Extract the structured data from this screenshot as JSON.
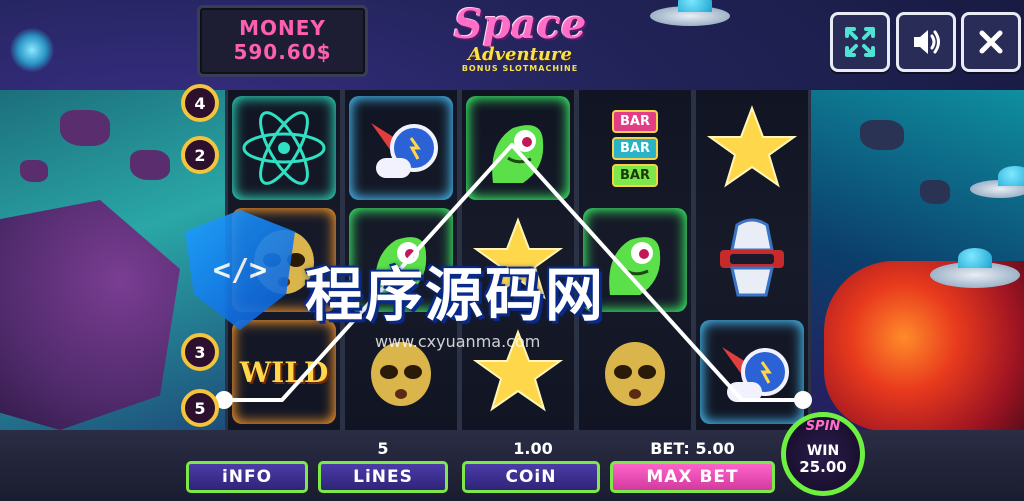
{
  "header": {
    "money_label": "MONEY",
    "money_value": "590.60$",
    "logo_main": "Space",
    "logo_sub": "Adventure",
    "logo_tag": "BONUS SLOTMACHINE"
  },
  "top_buttons": [
    {
      "name": "fullscreen-button",
      "icon": "fullscreen-icon"
    },
    {
      "name": "sound-button",
      "icon": "speaker-icon"
    },
    {
      "name": "close-button",
      "icon": "close-icon"
    }
  ],
  "line_markers": [
    "4",
    "2",
    "3",
    "5"
  ],
  "reels": [
    [
      {
        "symbol": "atom",
        "glow": "teal"
      },
      {
        "symbol": "alien-head",
        "glow": "orange"
      },
      {
        "symbol": "wild",
        "glow": "orange",
        "text": "WILD"
      }
    ],
    [
      {
        "symbol": "rocket",
        "glow": "blue"
      },
      {
        "symbol": "green-alien",
        "glow": "green"
      },
      {
        "symbol": "alien-head",
        "glow": "none"
      }
    ],
    [
      {
        "symbol": "green-alien",
        "glow": "green"
      },
      {
        "symbol": "space-star",
        "glow": "none"
      },
      {
        "symbol": "space-star",
        "glow": "none"
      }
    ],
    [
      {
        "symbol": "bar",
        "glow": "none",
        "text": [
          "BAR",
          "BAR",
          "BAR"
        ]
      },
      {
        "symbol": "green-alien",
        "glow": "green"
      },
      {
        "symbol": "alien-head",
        "glow": "none"
      }
    ],
    [
      {
        "symbol": "space-star",
        "glow": "none"
      },
      {
        "symbol": "robot",
        "glow": "none"
      },
      {
        "symbol": "rocket",
        "glow": "blue"
      }
    ]
  ],
  "bottom": {
    "lines_value": "5",
    "coin_value": "1.00",
    "bet_text": "BET: 5.00",
    "info_label": "iNFO",
    "lines_label": "LiNES",
    "coin_label": "COiN",
    "maxbet_label": "MAX BET",
    "spin_label": "SPIN",
    "win_label": "WIN",
    "win_value": "25.00"
  },
  "watermark": {
    "code_glyph": "</>",
    "text": "程序源码网",
    "url": "www.cxyuanma.com"
  },
  "colors": {
    "accent_pink": "#ff5fb0",
    "accent_green": "#7ee84b",
    "marker_gold": "#f4c43b",
    "line_white": "#ffffff"
  }
}
